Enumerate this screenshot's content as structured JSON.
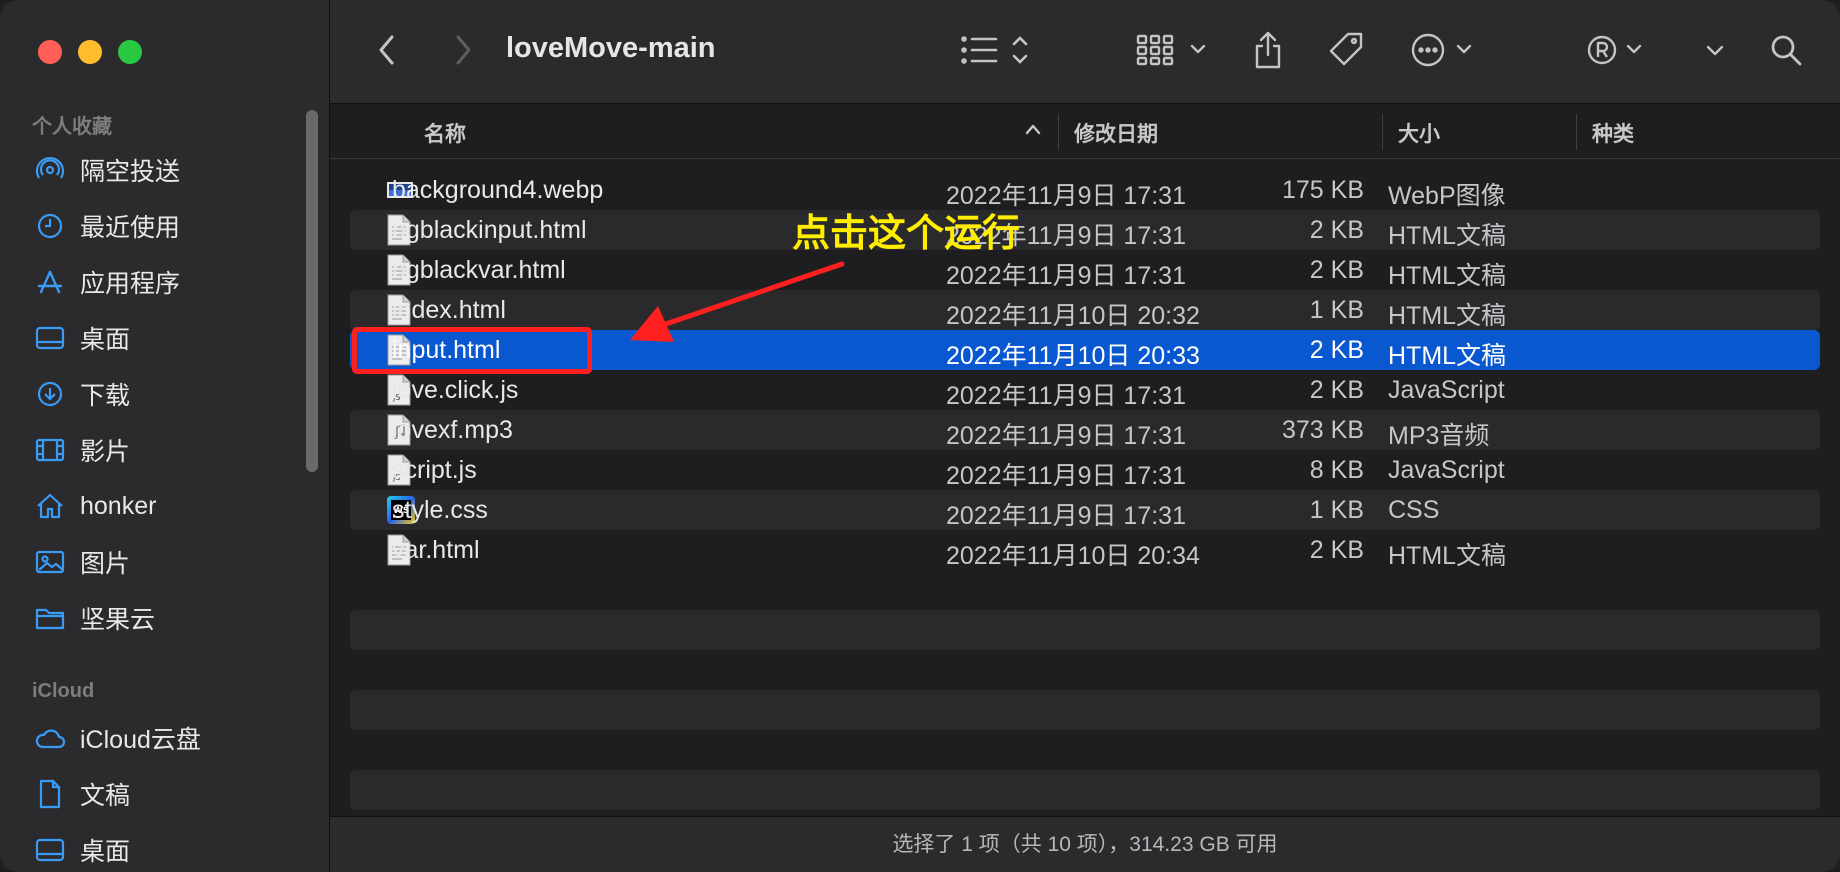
{
  "sidebar": {
    "favorites_title": "个人收藏",
    "favorites": [
      {
        "label": "隔空投送",
        "icon": "airdrop-icon"
      },
      {
        "label": "最近使用",
        "icon": "clock-icon"
      },
      {
        "label": "应用程序",
        "icon": "applications-icon"
      },
      {
        "label": "桌面",
        "icon": "desktop-icon"
      },
      {
        "label": "下载",
        "icon": "download-icon"
      },
      {
        "label": "影片",
        "icon": "film-icon"
      },
      {
        "label": "honker",
        "icon": "home-icon"
      },
      {
        "label": "图片",
        "icon": "photo-icon"
      },
      {
        "label": "坚果云",
        "icon": "folder-icon"
      }
    ],
    "icloud_title": "iCloud",
    "icloud": [
      {
        "label": "iCloud云盘",
        "icon": "cloud-icon"
      },
      {
        "label": "文稿",
        "icon": "document-icon"
      },
      {
        "label": "桌面",
        "icon": "desktop-icon"
      }
    ]
  },
  "toolbar": {
    "title": "loveMove-main"
  },
  "columns": {
    "name": "名称",
    "date": "修改日期",
    "size": "大小",
    "kind": "种类"
  },
  "files": [
    {
      "name": "background4.webp",
      "date": "2022年11月9日 17:31",
      "size": "175 KB",
      "kind": "WebP图像",
      "icon": "image-file-icon"
    },
    {
      "name": "bgblackinput.html",
      "date": "2022年11月9日 17:31",
      "size": "2 KB",
      "kind": "HTML文稿",
      "icon": "document-file-icon"
    },
    {
      "name": "bgblackvar.html",
      "date": "2022年11月9日 17:31",
      "size": "2 KB",
      "kind": "HTML文稿",
      "icon": "document-file-icon"
    },
    {
      "name": "index.html",
      "date": "2022年11月10日 20:32",
      "size": "1 KB",
      "kind": "HTML文稿",
      "icon": "document-file-icon"
    },
    {
      "name": "input.html",
      "date": "2022年11月10日 20:33",
      "size": "2 KB",
      "kind": "HTML文稿",
      "icon": "document-file-icon",
      "selected": true
    },
    {
      "name": "love.click.js",
      "date": "2022年11月9日 17:31",
      "size": "2 KB",
      "kind": "JavaScript",
      "icon": "js-file-icon"
    },
    {
      "name": "lovexf.mp3",
      "date": "2022年11月9日 17:31",
      "size": "373 KB",
      "kind": "MP3音频",
      "icon": "audio-file-icon"
    },
    {
      "name": "script.js",
      "date": "2022年11月9日 17:31",
      "size": "8 KB",
      "kind": "JavaScript",
      "icon": "js-file-icon"
    },
    {
      "name": "style.css",
      "date": "2022年11月9日 17:31",
      "size": "1 KB",
      "kind": "CSS",
      "icon": "webstorm-file-icon"
    },
    {
      "name": "var.html",
      "date": "2022年11月10日 20:34",
      "size": "2 KB",
      "kind": "HTML文稿",
      "icon": "document-file-icon"
    }
  ],
  "status": "选择了 1 项（共 10 项），314.23 GB 可用",
  "annotation": "点击这个运行",
  "colors": {
    "selection": "#0a58d0",
    "annotation_text": "#ffee00",
    "annotation_arrow": "#ff1f1f"
  }
}
